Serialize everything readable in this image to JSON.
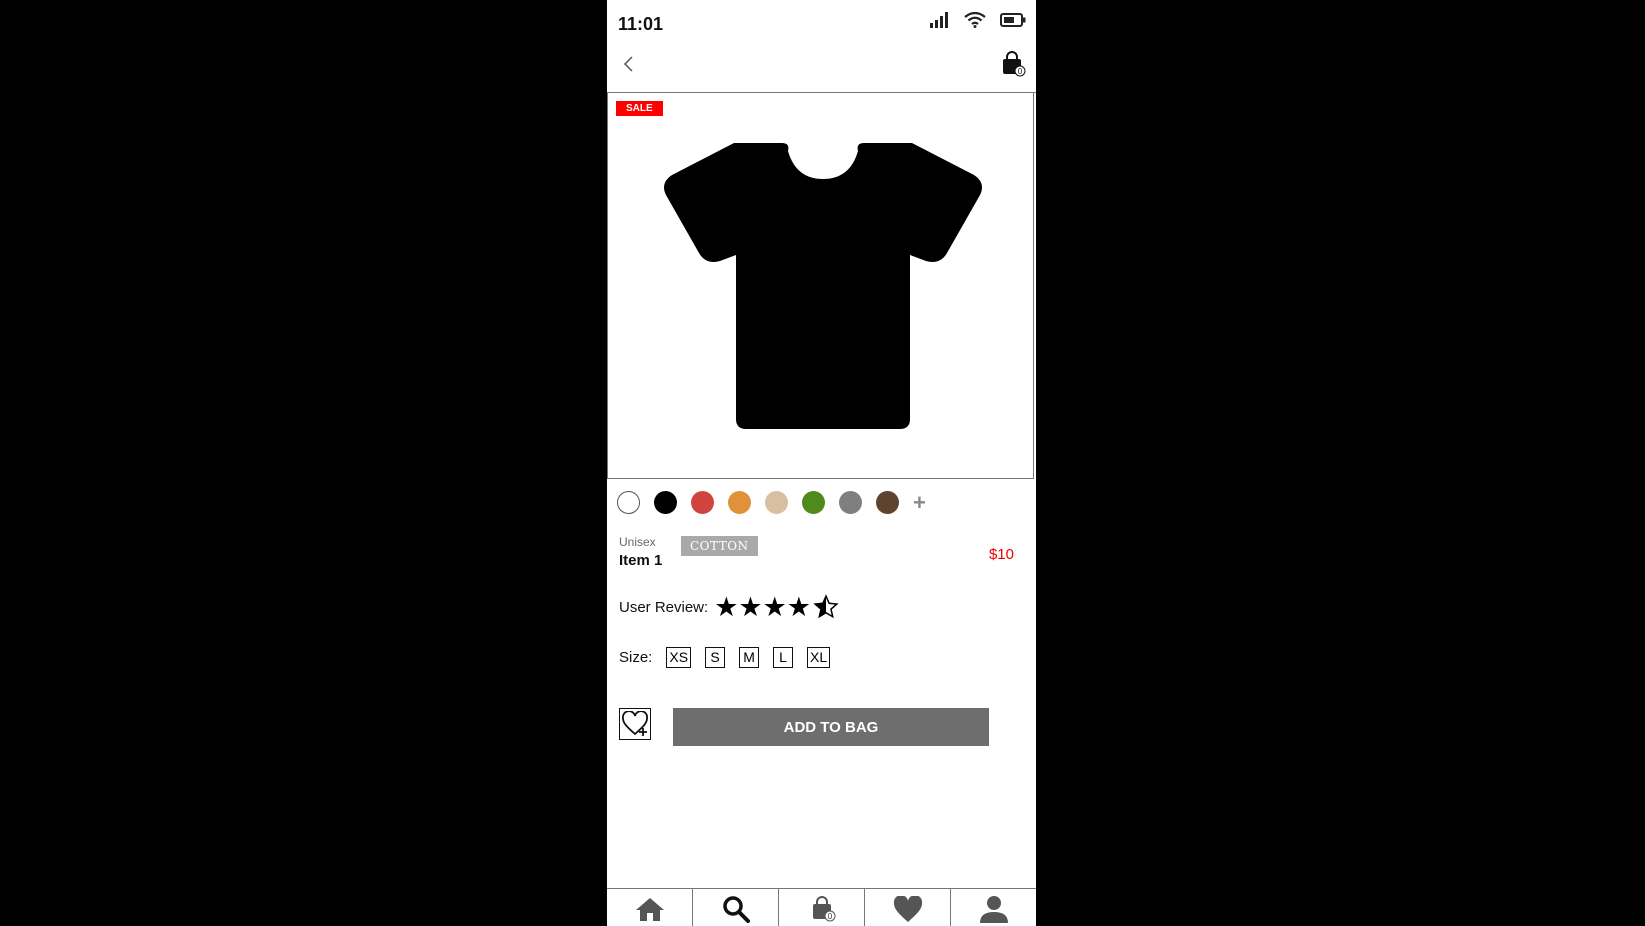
{
  "status_bar": {
    "time": "11:01"
  },
  "header": {
    "bag_count": "0"
  },
  "product": {
    "badge": "SALE",
    "gender": "Unisex",
    "name": "Item 1",
    "material": "COTTON",
    "price": "$10",
    "review_label": "User Review:",
    "rating": 4.5,
    "stars": "★★★★",
    "size_label": "Size:",
    "sizes": [
      "XS",
      "S",
      "M",
      "L",
      "XL"
    ]
  },
  "swatches": {
    "colors": [
      "#ffffff",
      "#000000",
      "#d0443f",
      "#e0913a",
      "#d8bfa2",
      "#4f8a1c",
      "#7f7f7f",
      "#5d4330"
    ],
    "more": "+"
  },
  "actions": {
    "add_to_bag": "ADD TO BAG"
  },
  "tabbar": {
    "items": [
      "home-icon",
      "search-icon",
      "bag-icon",
      "heart-icon",
      "user-icon"
    ],
    "bag_count": "0"
  }
}
